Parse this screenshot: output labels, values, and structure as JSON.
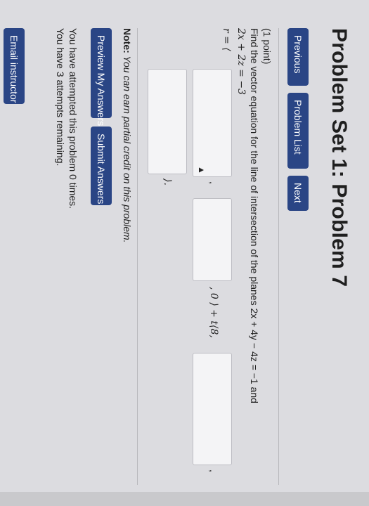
{
  "page_title": "Problem Set 1: Problem 7",
  "nav": {
    "previous": "Previous",
    "problem_list": "Problem List",
    "next": "Next"
  },
  "problem": {
    "points": "(1 point)",
    "statement": "Find the vector equation for the line of intersection of the planes 2x + 4y − 4z = −1 and",
    "plane2": "2x + 2z = −3",
    "r_start": "r = ⟨",
    "mid_comma": ",",
    "mid_text": ", 0 ⟩ + t⟨8,",
    "trail_comma": ",",
    "close": "⟩."
  },
  "note": {
    "label": "Note:",
    "text": "You can earn partial credit on this problem."
  },
  "actions": {
    "preview": "Preview My Answers",
    "submit": "Submit Answers"
  },
  "attempts": {
    "line1": "You have attempted this problem 0 times.",
    "line2": "You have 3 attempts remaining."
  },
  "footer": {
    "email": "Email instructor"
  },
  "colors": {
    "button_bg": "#2a4585",
    "page_bg": "#dcdce0"
  }
}
